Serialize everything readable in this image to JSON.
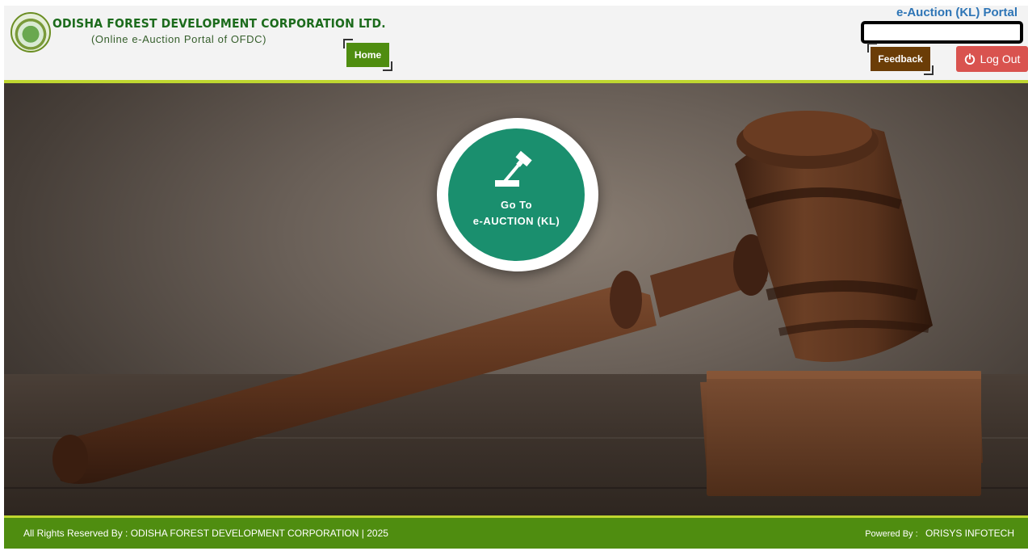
{
  "header": {
    "org_name": "ODISHA FOREST  DEVELOPMENT CORPORATION LTD.",
    "org_subtitle": "(Online e-Auction Portal of OFDC)",
    "portal_title": "e-Auction (KL) Portal",
    "home_label": "Home",
    "feedback_label": "Feedback",
    "logout_label": "Log Out",
    "user_display": ""
  },
  "hero": {
    "goto_line1": "Go To",
    "goto_line2": "e-AUCTION (KL)"
  },
  "footer": {
    "rights_text": "All Rights Reserved By : ODISHA FOREST DEVELOPMENT CORPORATION | 2025",
    "powered_label": "Powered By :",
    "powered_value": "ORISYS INFOTECH"
  },
  "icons": {
    "logo": "ofdc-seal-logo",
    "goto": "gavel-icon",
    "logout": "power-icon"
  },
  "colors": {
    "brand_green": "#4f8d10",
    "accent_lime": "#bfd630",
    "feedback_brown": "#6b3d07",
    "logout_red": "#d9534f",
    "portal_blue": "#2e75b6",
    "goto_teal": "#1a8f6e"
  }
}
